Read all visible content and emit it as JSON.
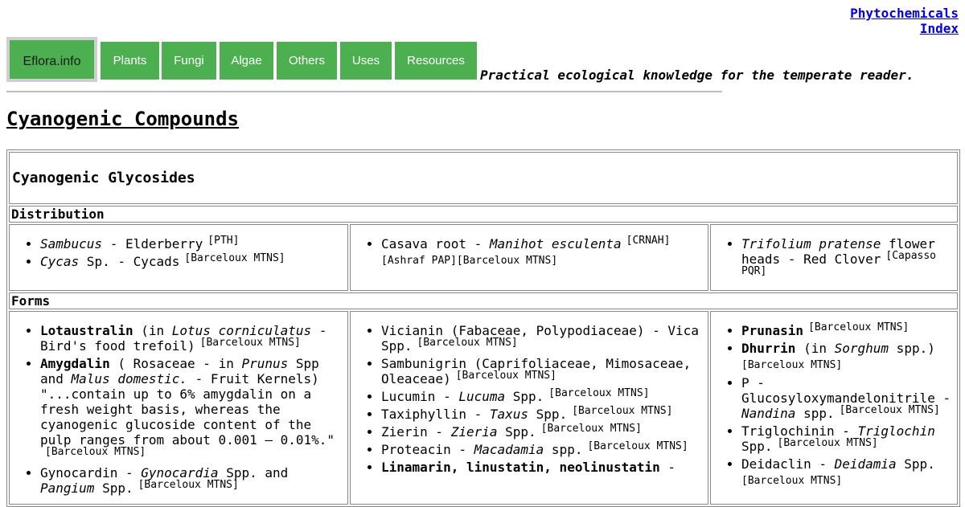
{
  "header": {
    "top_link_line1": "Phytochemicals",
    "top_link_line2": "Index",
    "nav": [
      "Eflora.info",
      "Plants",
      "Fungi",
      "Algae",
      "Others",
      "Uses",
      "Resources"
    ],
    "tagline": "Practical ecological knowledge for the temperate reader."
  },
  "page_title": "Cyanogenic Compounds",
  "table": {
    "heading": "Cyanogenic Glycosides",
    "distribution_label": "Distribution",
    "forms_label": "Forms",
    "distribution": {
      "col1": [
        {
          "a": "Sambucus",
          "b": " - Elderberry",
          "ref": "[PTH]"
        },
        {
          "a": "Cycas",
          "b": " Sp. - Cycads",
          "ref": "[Barceloux MTNS]"
        }
      ],
      "col2": [
        {
          "a": "Casava root - ",
          "b": "Manihot esculenta",
          "ref": "[CRNAH]",
          "ref2": "[Ashraf PAP][Barceloux MTNS]"
        }
      ],
      "col3": [
        {
          "a": "Trifolium pratense",
          "b": " flower heads - Red Clover",
          "ref": "[Capasso PQR]"
        }
      ]
    },
    "forms": {
      "col1": [
        {
          "name": "Lotaustralin",
          "t1": " (in ",
          "i1": "Lotus corniculatus",
          "t2": " - Bird's food trefoil)",
          "ref": "[Barceloux MTNS]"
        },
        {
          "name": "Amygdalin",
          "t1": " ( Rosaceae - in ",
          "i1": "Prunus",
          "t2": " Spp and ",
          "i2": "Malus domestic.",
          "t3": " - Fruit Kernels) \"...contain up to 6% amygdalin on a fresh weight basis, whereas the cyanogenic glucoside content of the pulp ranges from about 0.001 – 0.01%.\"",
          "ref": "[Barceloux MTNS]"
        },
        {
          "t0": "Gynocardin - ",
          "i1": "Gynocardia",
          "t1": " Spp. and ",
          "i2": "Pangium",
          "t2": " Spp.",
          "ref": "[Barceloux MTNS]"
        }
      ],
      "col2": [
        {
          "t0": "Vicianin (Fabaceae, Polypodiaceae) - Vica Spp.",
          "ref": "[Barceloux MTNS]"
        },
        {
          "t0": "Sambunigrin (Caprifoliaceae, Mimosaceae, Oleaceae)",
          "ref": "[Barceloux MTNS]"
        },
        {
          "t0": "Lucumin - ",
          "i1": "Lucuma",
          "t1": " Spp.",
          "ref": "[Barceloux MTNS]"
        },
        {
          "t0": "Taxiphyllin - ",
          "i1": "Taxus",
          "t1": " Spp.",
          "ref": "[Barceloux MTNS]"
        },
        {
          "t0": "Zierin - ",
          "i1": "Zieria",
          "t1": " Spp.",
          "ref": "[Barceloux MTNS]"
        },
        {
          "t0": "Proteacin - ",
          "i1": "Macadamia",
          "t1": " spp.",
          "ref": "[Barceloux MTNS]"
        },
        {
          "name": "Linamarin, linustatin, neolinustatin",
          "t1": " -"
        }
      ],
      "col3": [
        {
          "name": "Prunasin",
          "ref": "[Barceloux MTNS]"
        },
        {
          "name": "Dhurrin",
          "t1": " (in ",
          "i1": "Sorghum",
          "t2": " spp.)",
          "ref": "[Barceloux MTNS]"
        },
        {
          "t0": "P - Glucosyloxymandelonitrile - ",
          "i1": "Nandina",
          "t1": " spp.",
          "ref": "[Barceloux MTNS]"
        },
        {
          "t0": "Triglochinin - ",
          "i1": "Triglochin",
          "t1": " Spp.",
          "ref": "[Barceloux MTNS]"
        },
        {
          "t0": "Deidaclin - ",
          "i1": "Deidamia",
          "t1": " Spp.",
          "ref": "[Barceloux MTNS]"
        }
      ]
    }
  }
}
